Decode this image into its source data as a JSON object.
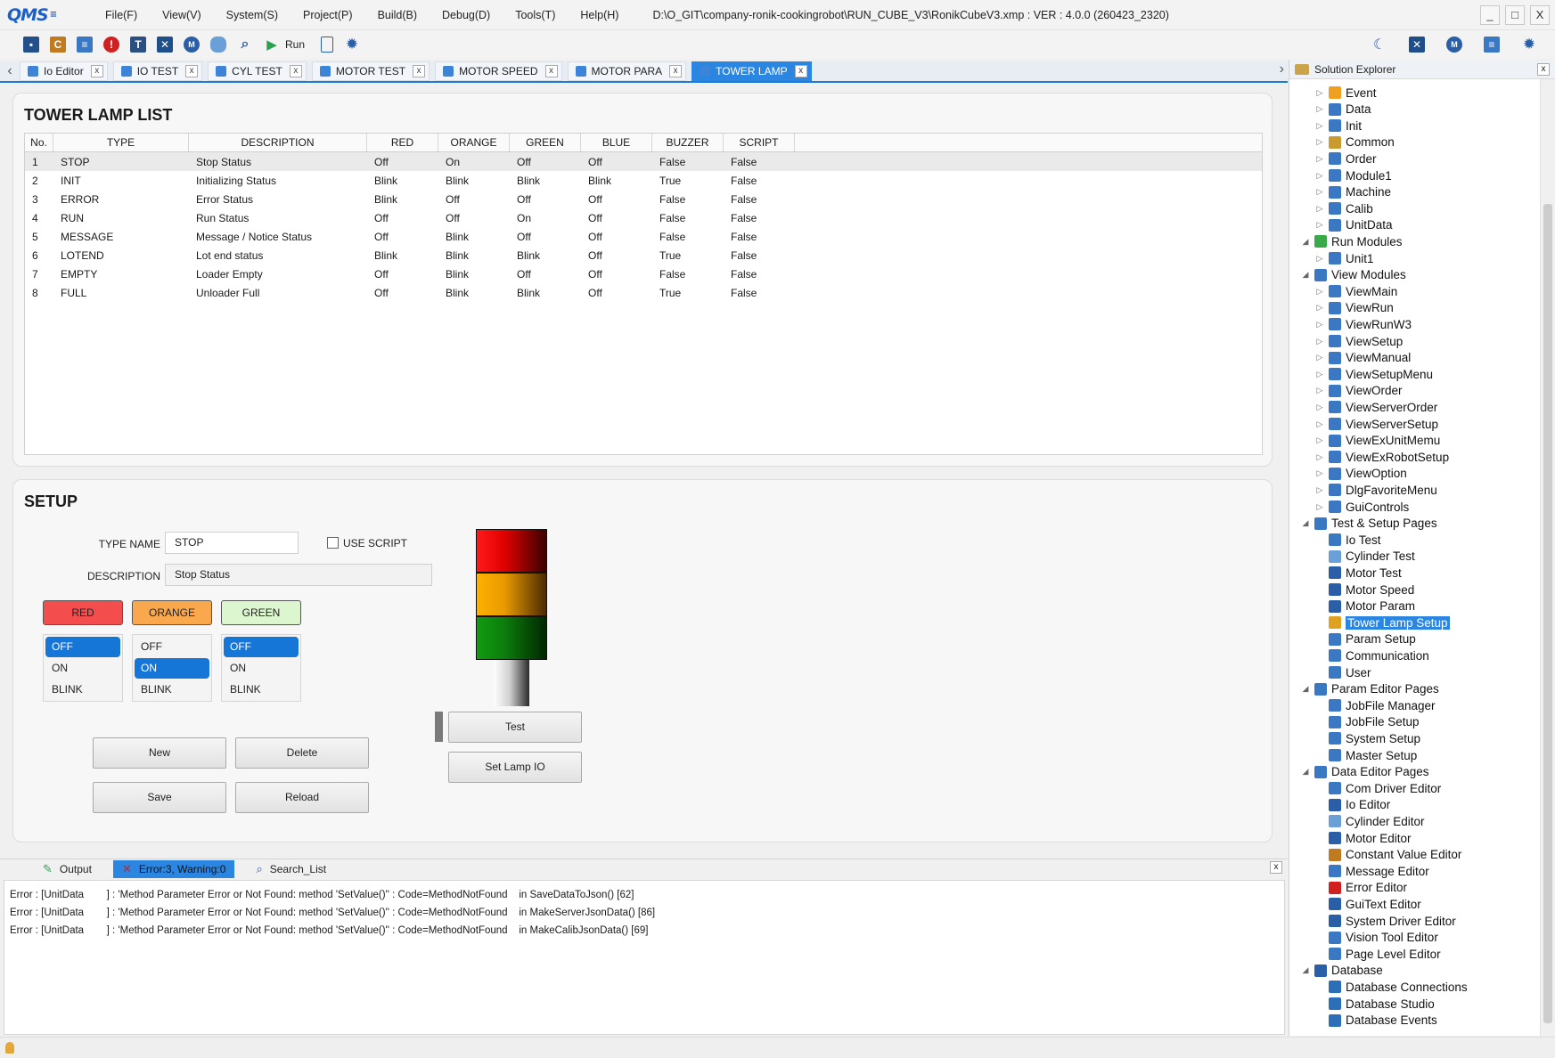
{
  "app": {
    "logo": "QMS",
    "menu": [
      "File(F)",
      "View(V)",
      "System(S)",
      "Project(P)",
      "Build(B)",
      "Debug(D)",
      "Tools(T)",
      "Help(H)"
    ],
    "path": "D:\\O_GIT\\company-ronik-cookingrobot\\RUN_CUBE_V3\\RonikCubeV3.xmp :  VER : 4.0.0 (260423_2320)",
    "window_controls": [
      "_",
      "□",
      "X"
    ]
  },
  "toolbar": {
    "icons": [
      "save-icon",
      "constant-icon",
      "message-icon",
      "error-icon",
      "guitext-icon",
      "io-icon",
      "motor-icon",
      "database-icon",
      "search-icon",
      "run-icon",
      "export-icon",
      "settings-icon"
    ],
    "run_label": "Run"
  },
  "tabs": [
    {
      "label": "Io Editor",
      "active": false
    },
    {
      "label": "IO TEST",
      "active": false
    },
    {
      "label": "CYL TEST",
      "active": false
    },
    {
      "label": "MOTOR TEST",
      "active": false
    },
    {
      "label": "MOTOR SPEED",
      "active": false
    },
    {
      "label": "MOTOR PARA",
      "active": false
    },
    {
      "label": "TOWER LAMP",
      "active": true
    }
  ],
  "tab_close": "x",
  "list": {
    "title": "TOWER LAMP LIST",
    "columns": [
      "No.",
      "TYPE",
      "DESCRIPTION",
      "RED",
      "ORANGE",
      "GREEN",
      "BLUE",
      "BUZZER",
      "SCRIPT"
    ],
    "rows": [
      [
        "1",
        "STOP",
        "Stop Status",
        "Off",
        "On",
        "Off",
        "Off",
        "False",
        "False"
      ],
      [
        "2",
        "INIT",
        "Initializing Status",
        "Blink",
        "Blink",
        "Blink",
        "Blink",
        "True",
        "False"
      ],
      [
        "3",
        "ERROR",
        "Error Status",
        "Blink",
        "Off",
        "Off",
        "Off",
        "False",
        "False"
      ],
      [
        "4",
        "RUN",
        "Run Status",
        "Off",
        "Off",
        "On",
        "Off",
        "False",
        "False"
      ],
      [
        "5",
        "MESSAGE",
        "Message / Notice Status",
        "Off",
        "Blink",
        "Off",
        "Off",
        "False",
        "False"
      ],
      [
        "6",
        "LOTEND",
        "Lot end status",
        "Blink",
        "Blink",
        "Blink",
        "Off",
        "True",
        "False"
      ],
      [
        "7",
        "EMPTY",
        "Loader Empty",
        "Off",
        "Blink",
        "Off",
        "Off",
        "False",
        "False"
      ],
      [
        "8",
        "FULL",
        "Unloader Full",
        "Off",
        "Blink",
        "Blink",
        "Off",
        "True",
        "False"
      ]
    ],
    "selected_row": 0
  },
  "setup": {
    "title": "SETUP",
    "type_name_label": "TYPE NAME",
    "type_name_value": "STOP",
    "use_script_label": "USE SCRIPT",
    "use_script_checked": false,
    "description_label": "DESCRIPTION",
    "description_value": "Stop Status",
    "lamps": [
      {
        "label": "RED",
        "color": "#f44d4d",
        "options": [
          "OFF",
          "ON",
          "BLINK"
        ],
        "selected": "OFF"
      },
      {
        "label": "ORANGE",
        "color": "#f9a84e",
        "options": [
          "OFF",
          "ON",
          "BLINK"
        ],
        "selected": "ON"
      },
      {
        "label": "GREEN",
        "color": "#dcf7cf",
        "options": [
          "OFF",
          "ON",
          "BLINK"
        ],
        "selected": "OFF"
      }
    ],
    "buttons": {
      "new": "New",
      "delete": "Delete",
      "save": "Save",
      "reload": "Reload",
      "test": "Test",
      "set_lamp_io": "Set Lamp IO"
    }
  },
  "output": {
    "tabs": [
      {
        "label": "Output",
        "active": false
      },
      {
        "label": "Error:3, Warning:0",
        "active": true
      },
      {
        "label": "Search_List",
        "active": false
      }
    ],
    "close": "x",
    "lines": [
      "Error : [UnitData        ] : 'Method Parameter Error or Not Found: method 'SetValue()'' : Code=MethodNotFound    in SaveDataToJson() [62]",
      "Error : [UnitData        ] : 'Method Parameter Error or Not Found: method 'SetValue()'' : Code=MethodNotFound    in MakeServerJsonData() [86]",
      "Error : [UnitData        ] : 'Method Parameter Error or Not Found: method 'SetValue()'' : Code=MethodNotFound    in MakeCalibJsonData() [69]"
    ]
  },
  "solution_explorer": {
    "title": "Solution Explorer",
    "close": "x",
    "items": [
      {
        "label": "Event",
        "level": 2,
        "icon": "event-icon",
        "color": "#f0a020"
      },
      {
        "label": "Data",
        "level": 2,
        "icon": "data-icon",
        "color": "#3a78c4"
      },
      {
        "label": "Init",
        "level": 2,
        "icon": "init-icon",
        "color": "#3a78c4"
      },
      {
        "label": "Common",
        "level": 2,
        "icon": "common-icon",
        "color": "#c99a2e"
      },
      {
        "label": "Order",
        "level": 2,
        "icon": "order-icon",
        "color": "#3a78c4"
      },
      {
        "label": "Module1",
        "level": 2,
        "icon": "module-icon",
        "color": "#3a78c4"
      },
      {
        "label": "Machine",
        "level": 2,
        "icon": "machine-icon",
        "color": "#3a78c4"
      },
      {
        "label": "Calib",
        "level": 2,
        "icon": "calib-icon",
        "color": "#3a78c4"
      },
      {
        "label": "UnitData",
        "level": 2,
        "icon": "unitdata-icon",
        "color": "#3a78c4"
      },
      {
        "label": "Run Modules",
        "level": 1,
        "icon": "run-modules-icon",
        "color": "#3aa94a",
        "expanded": true
      },
      {
        "label": "Unit1",
        "level": 2,
        "icon": "unit-icon",
        "color": "#3a78c4"
      },
      {
        "label": "View Modules",
        "level": 1,
        "icon": "view-modules-icon",
        "color": "#3a78c4",
        "expanded": true
      },
      {
        "label": "ViewMain",
        "level": 2,
        "icon": "view-icon",
        "color": "#3a78c4"
      },
      {
        "label": "ViewRun",
        "level": 2,
        "icon": "view-icon",
        "color": "#3a78c4"
      },
      {
        "label": "ViewRunW3",
        "level": 2,
        "icon": "view-icon",
        "color": "#3a78c4"
      },
      {
        "label": "ViewSetup",
        "level": 2,
        "icon": "view-icon",
        "color": "#3a78c4"
      },
      {
        "label": "ViewManual",
        "level": 2,
        "icon": "view-icon",
        "color": "#3a78c4"
      },
      {
        "label": "ViewSetupMenu",
        "level": 2,
        "icon": "view-icon",
        "color": "#3a78c4"
      },
      {
        "label": "ViewOrder",
        "level": 2,
        "icon": "view-icon",
        "color": "#3a78c4"
      },
      {
        "label": "ViewServerOrder",
        "level": 2,
        "icon": "view-icon",
        "color": "#3a78c4"
      },
      {
        "label": "ViewServerSetup",
        "level": 2,
        "icon": "view-icon",
        "color": "#3a78c4"
      },
      {
        "label": "ViewExUnitMemu",
        "level": 2,
        "icon": "view-icon",
        "color": "#3a78c4"
      },
      {
        "label": "ViewExRobotSetup",
        "level": 2,
        "icon": "view-icon",
        "color": "#3a78c4"
      },
      {
        "label": "ViewOption",
        "level": 2,
        "icon": "view-icon",
        "color": "#3a78c4"
      },
      {
        "label": "DlgFavoriteMenu",
        "level": 2,
        "icon": "view-icon",
        "color": "#3a78c4"
      },
      {
        "label": "GuiControls",
        "level": 2,
        "icon": "view-icon",
        "color": "#3a78c4"
      },
      {
        "label": "Test & Setup Pages",
        "level": 1,
        "icon": "pages-icon",
        "color": "#3a78c4",
        "expanded": true
      },
      {
        "label": "Io Test",
        "level": 2,
        "icon": "io-test-icon",
        "color": "#3a78c4",
        "leaf": true
      },
      {
        "label": "Cylinder Test",
        "level": 2,
        "icon": "cylinder-icon",
        "color": "#6a9fd8",
        "leaf": true
      },
      {
        "label": "Motor Test",
        "level": 2,
        "icon": "motor-test-icon",
        "color": "#2a5fa8",
        "leaf": true
      },
      {
        "label": "Motor Speed",
        "level": 2,
        "icon": "motor-speed-icon",
        "color": "#2a5fa8",
        "leaf": true
      },
      {
        "label": "Motor Param",
        "level": 2,
        "icon": "motor-param-icon",
        "color": "#2a5fa8",
        "leaf": true
      },
      {
        "label": "Tower Lamp Setup",
        "level": 2,
        "icon": "tower-lamp-icon",
        "color": "#e0a020",
        "leaf": true,
        "selected": true
      },
      {
        "label": "Param Setup",
        "level": 2,
        "icon": "param-icon",
        "color": "#3a78c4",
        "leaf": true
      },
      {
        "label": "Communication",
        "level": 2,
        "icon": "communication-icon",
        "color": "#3a78c4",
        "leaf": true
      },
      {
        "label": "User",
        "level": 2,
        "icon": "user-icon",
        "color": "#3a78c4",
        "leaf": true
      },
      {
        "label": "Param Editor Pages",
        "level": 1,
        "icon": "pages-icon",
        "color": "#3a78c4",
        "expanded": true
      },
      {
        "label": "JobFile Manager",
        "level": 2,
        "icon": "file-icon",
        "color": "#3a78c4",
        "leaf": true
      },
      {
        "label": "JobFile Setup",
        "level": 2,
        "icon": "file-icon",
        "color": "#3a78c4",
        "leaf": true
      },
      {
        "label": "System Setup",
        "level": 2,
        "icon": "file-icon",
        "color": "#3a78c4",
        "leaf": true
      },
      {
        "label": "Master Setup",
        "level": 2,
        "icon": "file-icon",
        "color": "#3a78c4",
        "leaf": true
      },
      {
        "label": "Data Editor Pages",
        "level": 1,
        "icon": "pages-icon",
        "color": "#3a78c4",
        "expanded": true
      },
      {
        "label": "Com Driver Editor",
        "level": 2,
        "icon": "com-driver-icon",
        "color": "#3a78c4",
        "leaf": true
      },
      {
        "label": "Io Editor",
        "level": 2,
        "icon": "io-editor-icon",
        "color": "#2a5fa8",
        "leaf": true
      },
      {
        "label": "Cylinder Editor",
        "level": 2,
        "icon": "cylinder-icon",
        "color": "#6a9fd8",
        "leaf": true
      },
      {
        "label": "Motor Editor",
        "level": 2,
        "icon": "motor-icon",
        "color": "#2a5fa8",
        "leaf": true
      },
      {
        "label": "Constant Value Editor",
        "level": 2,
        "icon": "constant-icon",
        "color": "#c07a20",
        "leaf": true
      },
      {
        "label": "Message Editor",
        "level": 2,
        "icon": "message-icon",
        "color": "#3a78c4",
        "leaf": true
      },
      {
        "label": "Error Editor",
        "level": 2,
        "icon": "error-icon",
        "color": "#d02020",
        "leaf": true
      },
      {
        "label": "GuiText Editor",
        "level": 2,
        "icon": "guitext-icon",
        "color": "#2a5fa8",
        "leaf": true
      },
      {
        "label": "System Driver Editor",
        "level": 2,
        "icon": "system-driver-icon",
        "color": "#2a5fa8",
        "leaf": true
      },
      {
        "label": "Vision Tool Editor",
        "level": 2,
        "icon": "vision-icon",
        "color": "#3a78c4",
        "leaf": true
      },
      {
        "label": "Page Level Editor",
        "level": 2,
        "icon": "page-level-icon",
        "color": "#3a78c4",
        "leaf": true
      },
      {
        "label": "Database",
        "level": 1,
        "icon": "database-icon",
        "color": "#2a5fa8",
        "expanded": true
      },
      {
        "label": "Database Connections",
        "level": 2,
        "icon": "db-connections-icon",
        "color": "#2a6fb8",
        "leaf": true
      },
      {
        "label": "Database Studio",
        "level": 2,
        "icon": "db-studio-icon",
        "color": "#2a6fb8",
        "leaf": true
      },
      {
        "label": "Database Events",
        "level": 2,
        "icon": "db-events-icon",
        "color": "#2a6fb8",
        "leaf": true
      }
    ]
  }
}
